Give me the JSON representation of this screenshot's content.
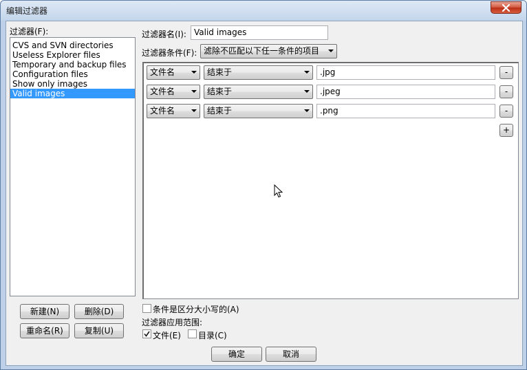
{
  "window": {
    "title": "编辑过滤器"
  },
  "filters": {
    "label": "过滤器(F):",
    "items": [
      {
        "label": "CVS and SVN directories",
        "selected": false
      },
      {
        "label": "Useless Explorer files",
        "selected": false
      },
      {
        "label": "Temporary and backup files",
        "selected": false
      },
      {
        "label": "Configuration files",
        "selected": false
      },
      {
        "label": "Show only images",
        "selected": false
      },
      {
        "label": "Valid images",
        "selected": true
      }
    ]
  },
  "buttons": {
    "new": "新建(N)",
    "delete": "删除(D)",
    "rename": "重命名(R)",
    "copy": "复制(U)",
    "ok": "确定",
    "cancel": "取消"
  },
  "filter_name": {
    "label": "过滤器名(I):",
    "value": "Valid images"
  },
  "filter_condition": {
    "label": "过滤器条件(F):",
    "value": "滤除不匹配以下任一条件的项目"
  },
  "conditions": [
    {
      "field": "文件名",
      "operator": "结束于",
      "value": ".jpg",
      "remove_label": "-"
    },
    {
      "field": "文件名",
      "operator": "结束于",
      "value": ".jpeg",
      "remove_label": "-"
    },
    {
      "field": "文件名",
      "operator": "结束于",
      "value": ".png",
      "remove_label": "-"
    }
  ],
  "add_label": "+",
  "case_sensitive": {
    "label": "条件是区分大小写的(A)",
    "checked": false
  },
  "scope": {
    "label": "过滤器应用范围:",
    "files": {
      "label": "文件(E)",
      "checked": true
    },
    "dirs": {
      "label": "目录(C)",
      "checked": false
    }
  }
}
